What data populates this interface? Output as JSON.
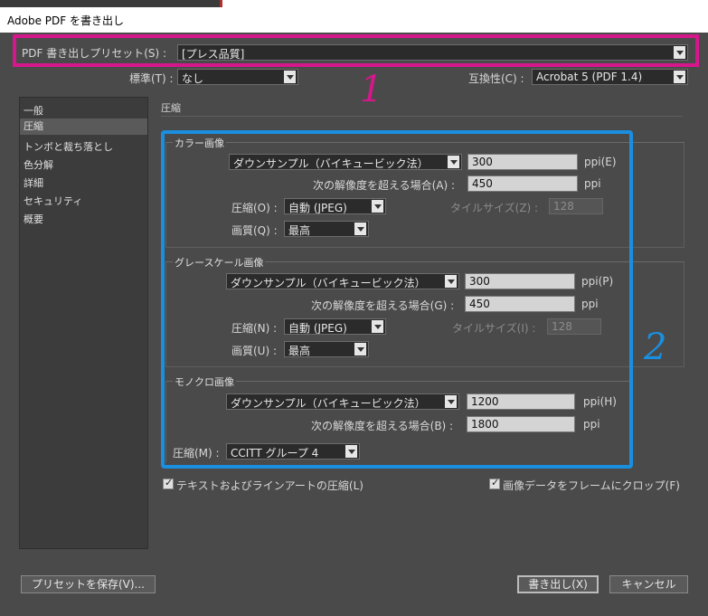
{
  "window": {
    "title": "Adobe PDF を書き出し"
  },
  "preset": {
    "label": "PDF 書き出しプリセット(S) :",
    "value": "[プレス品質]"
  },
  "standard": {
    "label": "標準(T) :",
    "value": "なし"
  },
  "compat": {
    "label": "互換性(C) :",
    "value": "Acrobat 5 (PDF 1.4)"
  },
  "sidebar": {
    "items": [
      {
        "label": "一般"
      },
      {
        "label": "圧縮"
      },
      {
        "label": "トンボと裁ち落とし"
      },
      {
        "label": "色分解"
      },
      {
        "label": "詳細"
      },
      {
        "label": "セキュリティ"
      },
      {
        "label": "概要"
      }
    ]
  },
  "section_title": "圧縮",
  "color": {
    "title": "カラー画像",
    "downsample": "ダウンサンプル（バイキュービック法）",
    "ppi_value": "300",
    "ppi_label": "ppi(E)",
    "above_label": "次の解像度を超える場合(A) :",
    "above_value": "450",
    "above_unit": "ppi",
    "compress_label": "圧縮(O) :",
    "compress_value": "自動 (JPEG)",
    "tile_label": "タイルサイズ(Z) :",
    "tile_value": "128",
    "quality_label": "画質(Q) :",
    "quality_value": "最高"
  },
  "gray": {
    "title": "グレースケール画像",
    "downsample": "ダウンサンプル（バイキュービック法）",
    "ppi_value": "300",
    "ppi_label": "ppi(P)",
    "above_label": "次の解像度を超える場合(G) :",
    "above_value": "450",
    "above_unit": "ppi",
    "compress_label": "圧縮(N) :",
    "compress_value": "自動 (JPEG)",
    "tile_label": "タイルサイズ(I) :",
    "tile_value": "128",
    "quality_label": "画質(U) :",
    "quality_value": "最高"
  },
  "mono": {
    "title": "モノクロ画像",
    "downsample": "ダウンサンプル（バイキュービック法）",
    "ppi_value": "1200",
    "ppi_label": "ppi(H)",
    "above_label": "次の解像度を超える場合(B) :",
    "above_value": "1800",
    "above_unit": "ppi",
    "compress_label": "圧縮(M) :",
    "compress_value": "CCITT グループ 4"
  },
  "options": {
    "text_art": "テキストおよびラインアートの圧縮(L)",
    "crop": "画像データをフレームにクロップ(F)"
  },
  "buttons": {
    "save_preset": "プリセットを保存(V)...",
    "export": "書き出し(X)",
    "cancel": "キャンセル"
  },
  "annotations": {
    "one": "1",
    "two": "2",
    "pink": "#d6178c",
    "blue": "#1a8fe0"
  }
}
